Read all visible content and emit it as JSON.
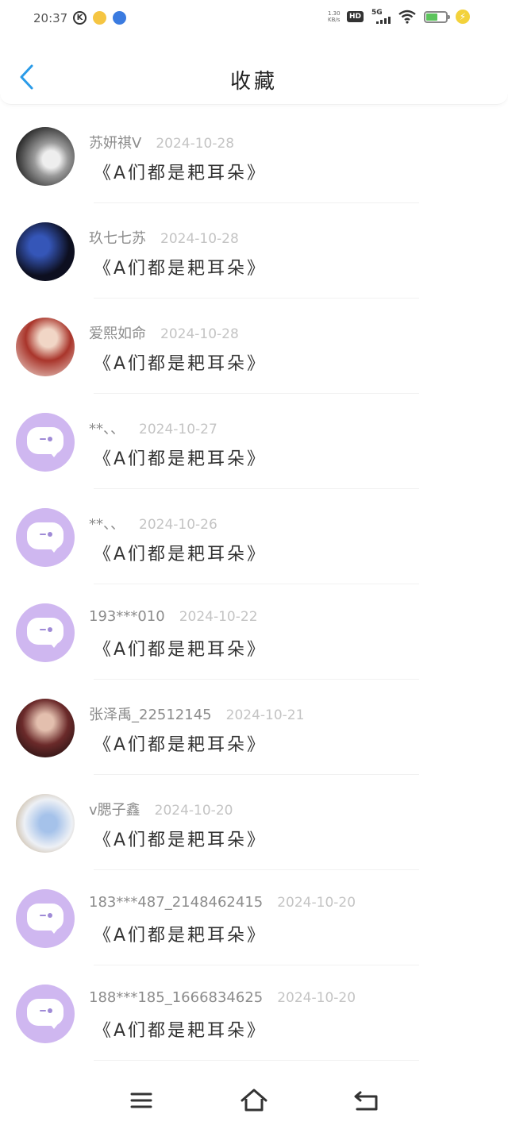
{
  "status_bar": {
    "time": "20:37",
    "network": "5G",
    "hd": "HD",
    "speed_value": "1.30",
    "speed_unit": "KB/s"
  },
  "header": {
    "title": "收藏"
  },
  "favorites": [
    {
      "user": "苏妍祺V",
      "date": "2024-10-28",
      "work": "《A们都是耙耳朵》",
      "avatar": "photo"
    },
    {
      "user": "玖七七苏",
      "date": "2024-10-28",
      "work": "《A们都是耙耳朵》",
      "avatar": "photo"
    },
    {
      "user": "爱熙如命",
      "date": "2024-10-28",
      "work": "《A们都是耙耳朵》",
      "avatar": "photo"
    },
    {
      "user": "**、、",
      "date": "2024-10-27",
      "work": "《A们都是耙耳朵》",
      "avatar": "default"
    },
    {
      "user": "**、、",
      "date": "2024-10-26",
      "work": "《A们都是耙耳朵》",
      "avatar": "default"
    },
    {
      "user": "193***010",
      "date": "2024-10-22",
      "work": "《A们都是耙耳朵》",
      "avatar": "default"
    },
    {
      "user": "张泽禹_22512145",
      "date": "2024-10-21",
      "work": "《A们都是耙耳朵》",
      "avatar": "photo"
    },
    {
      "user": "v腮子鑫",
      "date": "2024-10-20",
      "work": "《A们都是耙耳朵》",
      "avatar": "photo"
    },
    {
      "user": "183***487_2148462415",
      "date": "2024-10-20",
      "work": "《A们都是耙耳朵》",
      "avatar": "default"
    },
    {
      "user": "188***185_1666834625",
      "date": "2024-10-20",
      "work": "《A们都是耙耳朵》",
      "avatar": "default"
    }
  ],
  "colors": {
    "accent": "#2a9be8",
    "default_avatar": "#cfb7f0"
  },
  "icons": {
    "back": "chevron-left-icon",
    "menu": "menu-icon",
    "home": "home-icon",
    "return": "return-icon"
  }
}
